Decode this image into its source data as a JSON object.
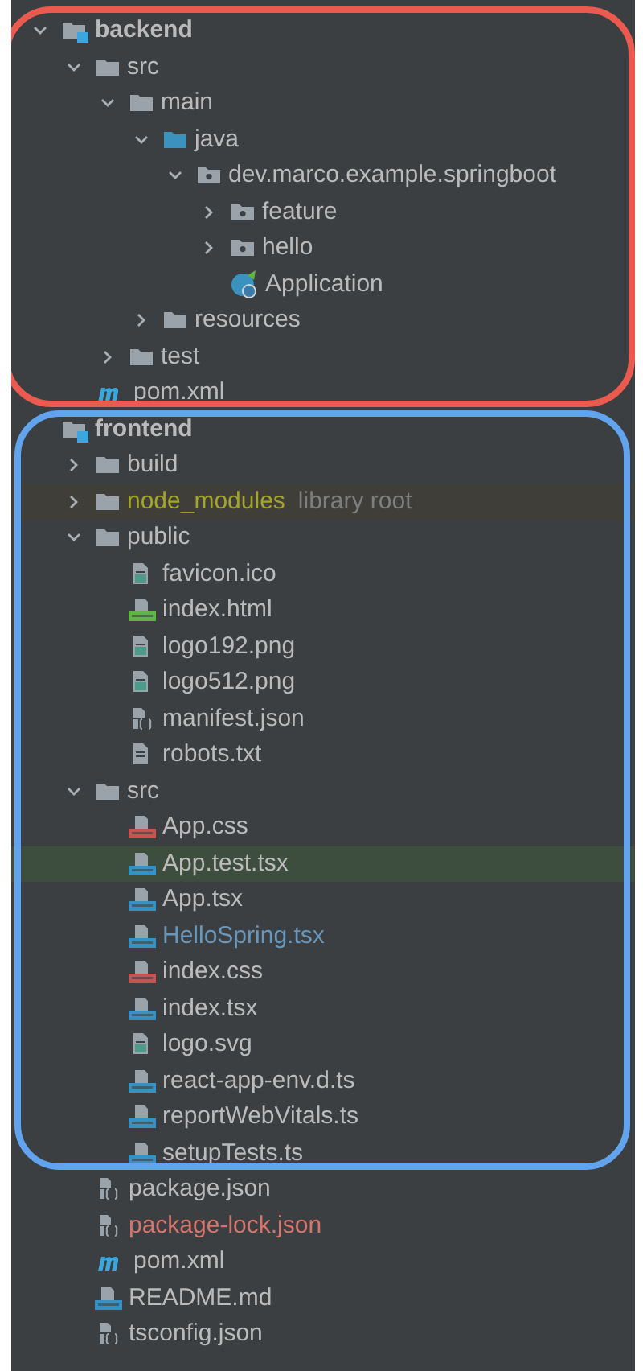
{
  "project_tree": [
    {
      "name": "backend",
      "kind": "module",
      "expanded": true,
      "selected": false,
      "children": [
        {
          "name": "src",
          "kind": "folder",
          "expanded": true,
          "selected": false,
          "children": [
            {
              "name": "main",
              "kind": "folder",
              "expanded": true,
              "selected": false,
              "children": [
                {
                  "name": "java",
                  "kind": "source-root",
                  "expanded": true,
                  "selected": false,
                  "children": [
                    {
                      "name": "dev.marco.example.springboot",
                      "kind": "package",
                      "expanded": true,
                      "selected": false,
                      "children": [
                        {
                          "name": "feature",
                          "kind": "package",
                          "expanded": false,
                          "selected": false
                        },
                        {
                          "name": "hello",
                          "kind": "package",
                          "expanded": false,
                          "selected": false
                        },
                        {
                          "name": "Application",
                          "kind": "spring-class",
                          "selected": false
                        }
                      ]
                    }
                  ]
                },
                {
                  "name": "resources",
                  "kind": "folder",
                  "expanded": false,
                  "selected": false
                }
              ]
            },
            {
              "name": "test",
              "kind": "folder",
              "expanded": false,
              "selected": false
            }
          ]
        },
        {
          "name": "pom.xml",
          "kind": "maven",
          "selected": false
        }
      ]
    },
    {
      "name": "frontend",
      "kind": "module",
      "selected": false,
      "children": [
        {
          "name": "build",
          "kind": "folder",
          "expanded": false,
          "selected": false
        },
        {
          "name": "node_modules",
          "kind": "folder",
          "color": "#a5a52a",
          "note": "library root",
          "expanded": false,
          "selected": false
        },
        {
          "name": "public",
          "kind": "folder",
          "expanded": true,
          "selected": false,
          "children": [
            {
              "name": "favicon.ico",
              "kind": "image",
              "selected": false
            },
            {
              "name": "index.html",
              "kind": "html",
              "selected": false
            },
            {
              "name": "logo192.png",
              "kind": "image",
              "selected": false
            },
            {
              "name": "logo512.png",
              "kind": "image",
              "selected": false
            },
            {
              "name": "manifest.json",
              "kind": "json",
              "selected": false
            },
            {
              "name": "robots.txt",
              "kind": "text",
              "selected": false
            }
          ]
        },
        {
          "name": "src",
          "kind": "folder",
          "expanded": true,
          "selected": false,
          "children": [
            {
              "name": "App.css",
              "kind": "css",
              "selected": false
            },
            {
              "name": "App.test.tsx",
              "kind": "tsx",
              "selected": true
            },
            {
              "name": "App.tsx",
              "kind": "tsx",
              "selected": false
            },
            {
              "name": "HelloSpring.tsx",
              "kind": "tsx",
              "color": "#6897bb",
              "selected": false
            },
            {
              "name": "index.css",
              "kind": "css",
              "selected": false
            },
            {
              "name": "index.tsx",
              "kind": "tsx",
              "selected": false
            },
            {
              "name": "logo.svg",
              "kind": "image",
              "selected": false
            },
            {
              "name": "react-app-env.d.ts",
              "kind": "ts",
              "selected": false
            },
            {
              "name": "reportWebVitals.ts",
              "kind": "ts",
              "selected": false
            },
            {
              "name": "setupTests.ts",
              "kind": "ts",
              "selected": false
            }
          ]
        },
        {
          "name": "package.json",
          "kind": "json",
          "selected": false
        },
        {
          "name": "package-lock.json",
          "kind": "json",
          "color": "#d5756c",
          "selected": false
        },
        {
          "name": "pom.xml",
          "kind": "maven",
          "selected": false
        },
        {
          "name": "README.md",
          "kind": "md",
          "selected": false
        },
        {
          "name": "tsconfig.json",
          "kind": "json",
          "selected": false
        }
      ]
    }
  ]
}
